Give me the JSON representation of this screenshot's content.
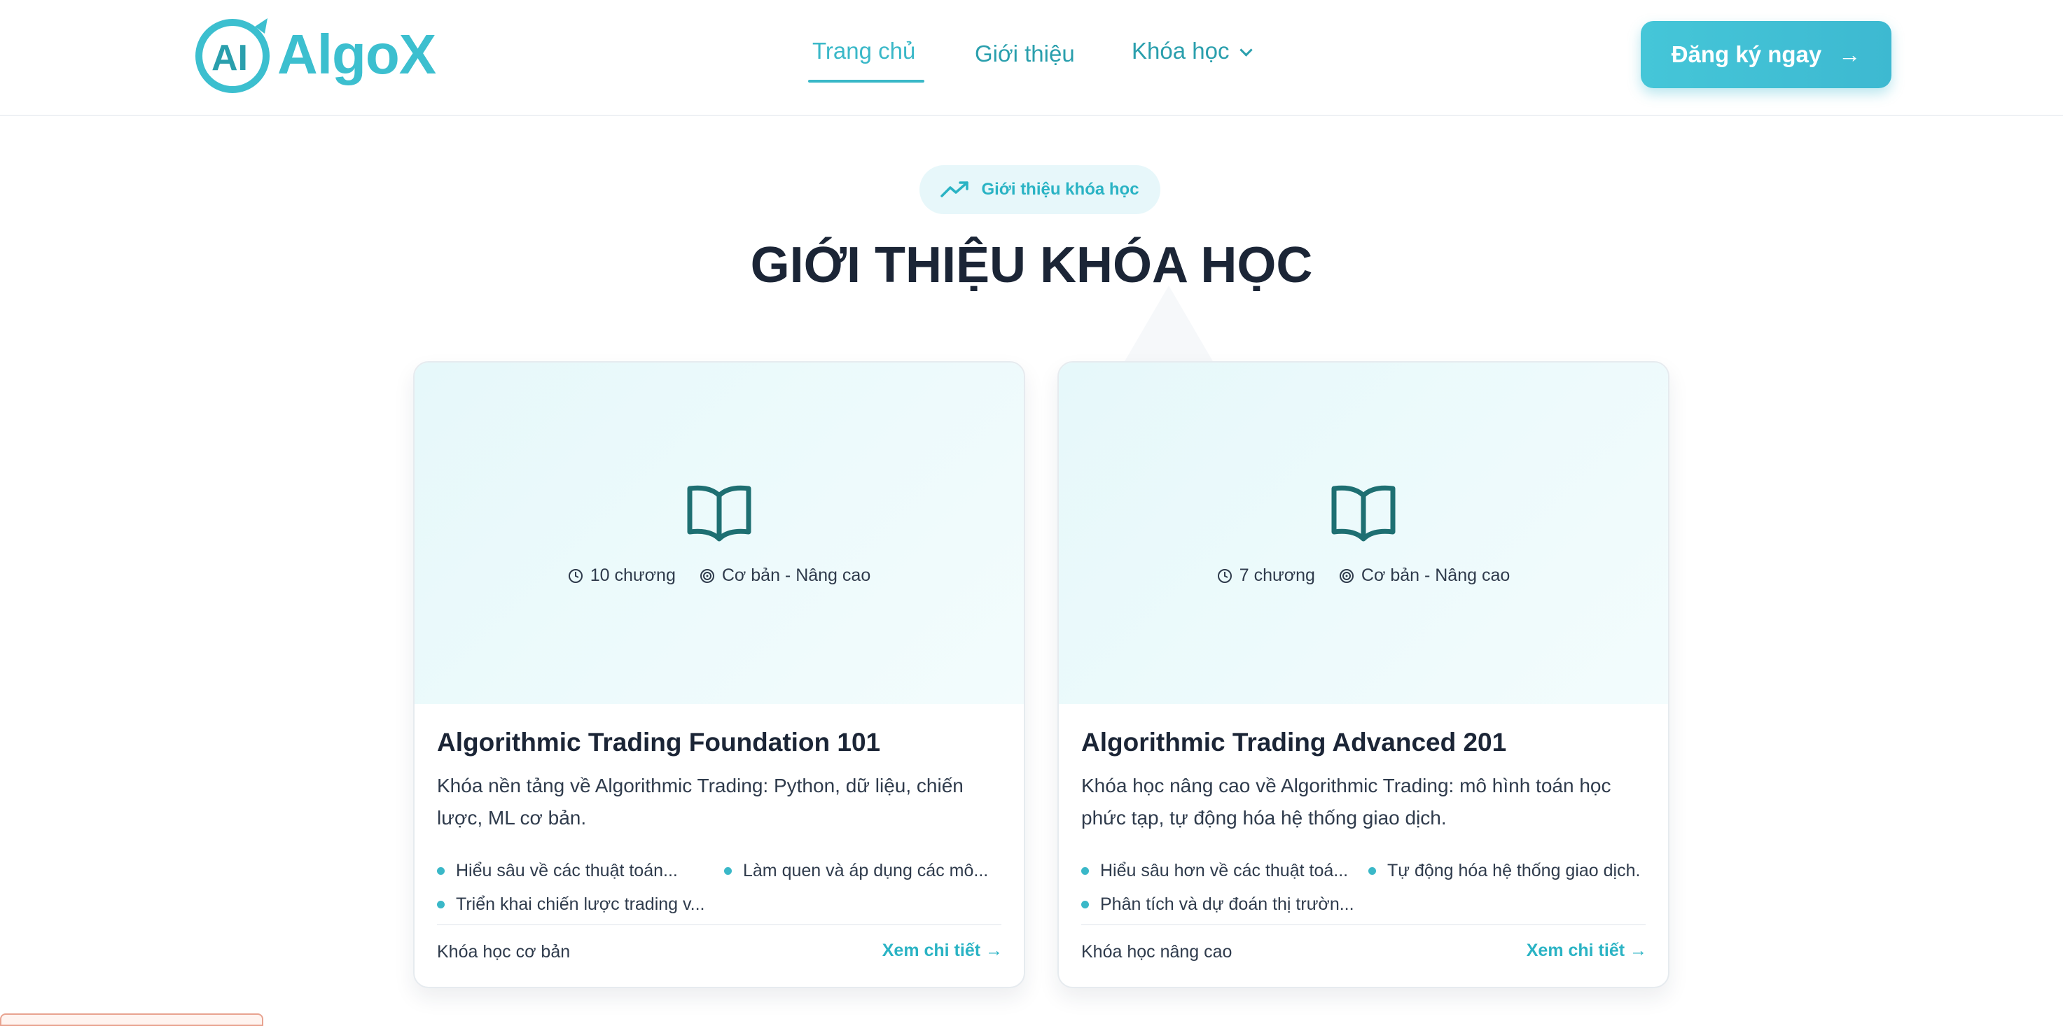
{
  "header": {
    "logo_text": "AlgoX",
    "nav": [
      {
        "label": "Trang chủ",
        "active": true
      },
      {
        "label": "Giới thiệu",
        "active": false
      },
      {
        "label": "Khóa học",
        "active": false,
        "has_dropdown": true
      }
    ],
    "cta_label": "Đăng ký ngay",
    "accent_color": "#3ab8c8"
  },
  "section": {
    "badge_label": "Giới thiệu khóa học",
    "title": "GIỚI THIỆU KHÓA HỌC"
  },
  "courses": [
    {
      "chapters": "10 chương",
      "level": "Cơ bản - Nâng cao",
      "title": "Algorithmic Trading Foundation 101",
      "description": "Khóa nền tảng về Algorithmic Trading: Python, dữ liệu, chiến lược, ML cơ bản.",
      "bullets": [
        "Hiểu sâu về các thuật toán...",
        "Làm quen và áp dụng các mô...",
        "Triển khai chiến lược trading v..."
      ],
      "footer_label": "Khóa học cơ bản",
      "link_label": "Xem chi tiết →"
    },
    {
      "chapters": "7 chương",
      "level": "Cơ bản - Nâng cao",
      "title": "Algorithmic Trading Advanced 201",
      "description": "Khóa học nâng cao về Algorithmic Trading: mô hình toán học phức tạp, tự động hóa hệ thống giao dịch.",
      "bullets": [
        "Hiểu sâu hơn về các thuật toá...",
        "Tự động hóa hệ thống giao dịch.",
        "Phân tích và dự đoán thị trườn..."
      ],
      "footer_label": "Khóa học nâng cao",
      "link_label": "Xem chi tiết →"
    }
  ]
}
